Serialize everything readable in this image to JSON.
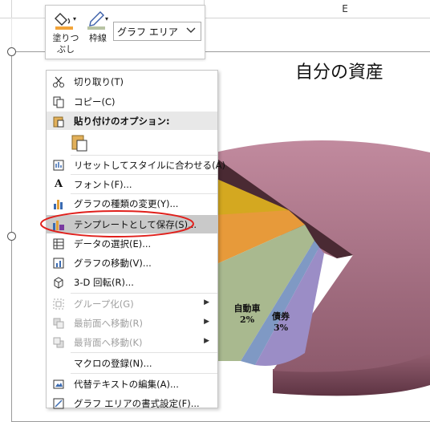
{
  "sheet": {
    "column_label": "E"
  },
  "chart": {
    "title": "自分の資産",
    "labels": [
      {
        "name": "自動車",
        "value": "2%"
      },
      {
        "name": "債券",
        "value": "3%"
      }
    ]
  },
  "mini_toolbar": {
    "fill_label_1": "塗りつ",
    "fill_label_2": "ぶし",
    "outline_label": "枠線",
    "element_value": "グラフ エリア"
  },
  "menu": {
    "cut": "切り取り(T)",
    "copy": "コピー(C)",
    "paste_options": "貼り付けのオプション:",
    "reset_style": "リセットしてスタイルに合わせる(A)",
    "font": "フォント(F)...",
    "change_type": "グラフの種類の変更(Y)...",
    "save_template": "テンプレートとして保存(S)...",
    "select_data": "データの選択(E)...",
    "move_chart": "グラフの移動(V)...",
    "rotate_3d": "3-D 回転(R)...",
    "group": "グループ化(G)",
    "bring_front": "最前面へ移動(R)",
    "send_back": "最背面へ移動(K)",
    "assign_macro": "マクロの登録(N)...",
    "alt_text": "代替テキストの編集(A)...",
    "format_area": "グラフ エリアの書式設定(F)..."
  },
  "colors": {
    "highlight_ellipse": "#e0201c",
    "pie_main": "#b07a8c",
    "fill_swatch": "#f2a43a"
  }
}
